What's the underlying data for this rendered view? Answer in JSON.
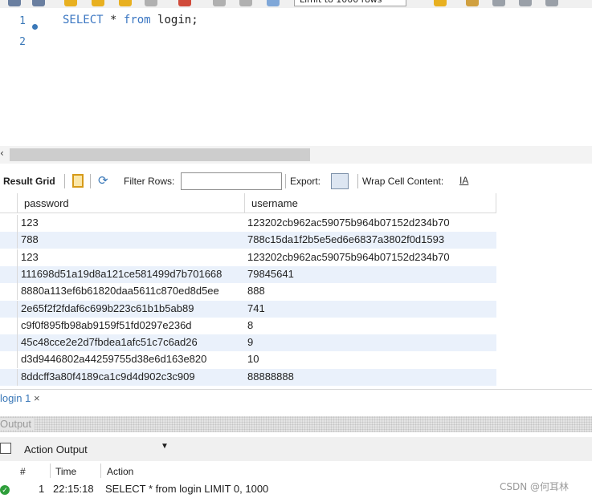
{
  "toolbar": {
    "limit_label": "Limit to 1000 rows"
  },
  "editor": {
    "line_numbers": [
      "1",
      "2"
    ],
    "kw_select": "SELECT",
    "star": "*",
    "kw_from": "from",
    "table": "login;"
  },
  "result_toolbar": {
    "result_grid": "Result Grid",
    "filter_rows": "Filter Rows:",
    "filter_value": "",
    "export": "Export:",
    "wrap": "Wrap Cell Content:"
  },
  "grid": {
    "columns": [
      "password",
      "username"
    ],
    "rows": [
      [
        "123",
        "123202cb962ac59075b964b07152d234b70"
      ],
      [
        "788",
        "788c15da1f2b5e5ed6e6837a3802f0d1593"
      ],
      [
        "123",
        "123202cb962ac59075b964b07152d234b70"
      ],
      [
        "111698d51a19d8a121ce581499d7b701668",
        "79845641"
      ],
      [
        "8880a113ef6b61820daa5611c870ed8d5ee",
        "888"
      ],
      [
        "2e65f2f2fdaf6c699b223c61b1b5ab89",
        "741"
      ],
      [
        "c9f0f895fb98ab9159f51fd0297e236d",
        "8"
      ],
      [
        "45c48cce2e2d7fbdea1afc51c7c6ad26",
        "9"
      ],
      [
        "d3d9446802a44259755d38e6d163e820",
        "10"
      ],
      [
        "8ddcff3a80f4189ca1c9d4d902c3c909",
        "88888888"
      ]
    ]
  },
  "tabs": {
    "active": "login 1",
    "close": "×"
  },
  "output": {
    "header": "Output",
    "selector": "Action Output",
    "columns": {
      "num": "#",
      "time": "Time",
      "action": "Action"
    },
    "row": {
      "num": "1",
      "time": "22:15:18",
      "action": "SELECT * from login LIMIT 0, 1000"
    }
  },
  "watermark": "CSDN @何耳林",
  "colors": {
    "accent": "#3a78b8",
    "alt_row": "#eaf1fb",
    "success": "#2e9e3a"
  }
}
